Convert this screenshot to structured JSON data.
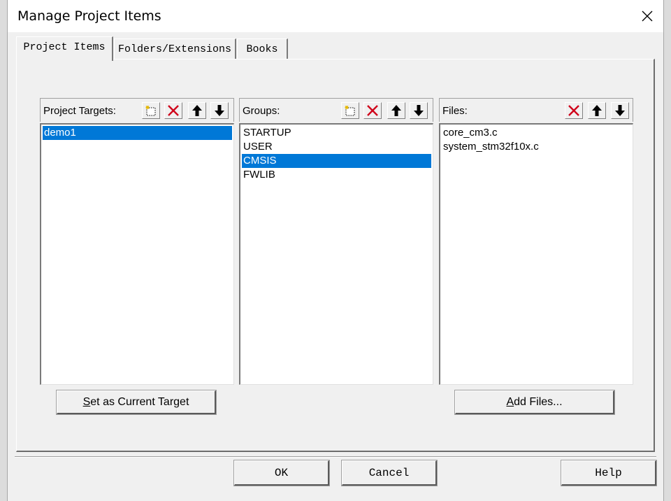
{
  "window": {
    "title": "Manage Project Items"
  },
  "tabs": [
    {
      "label": "Project Items",
      "active": true
    },
    {
      "label": "Folders/Extensions",
      "active": false
    },
    {
      "label": "Books",
      "active": false
    }
  ],
  "targets": {
    "label": "Project Targets:",
    "items": [
      "demo1"
    ],
    "selected": "demo1",
    "set_current_button": {
      "underline_char": "S",
      "rest": "et as Current Target"
    }
  },
  "groups": {
    "label": "Groups:",
    "items": [
      "STARTUP",
      "USER",
      "CMSIS",
      "FWLIB"
    ],
    "selected": "CMSIS"
  },
  "files": {
    "label": "Files:",
    "items": [
      "core_cm3.c",
      "system_stm32f10x.c"
    ],
    "add_files_button": {
      "underline_char": "A",
      "rest": "dd Files..."
    }
  },
  "footer": {
    "ok": "OK",
    "cancel": "Cancel",
    "help": "Help"
  },
  "colors": {
    "selection": "#0078d7",
    "delete_red": "#d0021b"
  }
}
